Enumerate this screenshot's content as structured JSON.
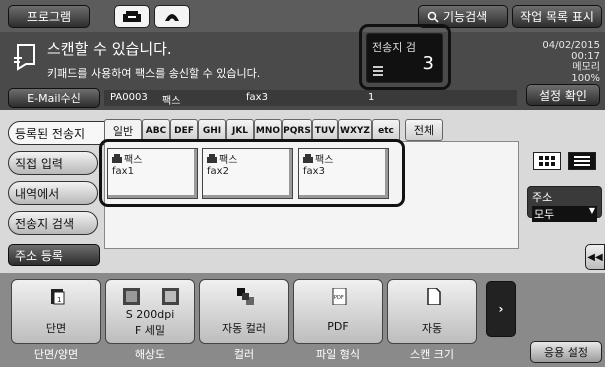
{
  "topbar": {
    "program_label": "프로그램",
    "function_search_label": "기능검색",
    "job_list_label": "작업 목록 표시"
  },
  "message": {
    "line1": "스캔할 수 있습니다.",
    "line2": "키패드를 사용하여 팩스를 송신할 수 있습니다.",
    "date": "04/02/2015",
    "time": "00:17",
    "memory_label": "메모리",
    "memory_value": "100%"
  },
  "destination_count": {
    "label": "전송지 검",
    "value": "3"
  },
  "email_receive_label": "E-Mail수신",
  "settings_confirm_label": "설정 확인",
  "dest_row": {
    "id": "PA0003",
    "type": "팩스",
    "name": "fax3",
    "count": "1"
  },
  "index_tabs": [
    "일반",
    "ABC",
    "DEF",
    "GHI",
    "JKL",
    "MNO",
    "PQRS",
    "TUV",
    "WXYZ",
    "etc"
  ],
  "all_tab_label": "전체",
  "destinations": [
    {
      "type": "팩스",
      "name": "fax1"
    },
    {
      "type": "팩스",
      "name": "fax2"
    },
    {
      "type": "팩스",
      "name": "fax3"
    }
  ],
  "left_menu": {
    "registered": "등록된 전송지",
    "direct": "직접 입력",
    "history": "내역에서",
    "search": "전송지 검색",
    "register": "주소 등록"
  },
  "address": {
    "label": "주소",
    "selected": "모두"
  },
  "function_buttons": [
    {
      "value": "단면",
      "sub": "",
      "label": "단면/양면",
      "icon": "simplex-icon"
    },
    {
      "value": "S 200dpi",
      "sub": "F 세밀",
      "label": "해상도",
      "icon": "resolution-icon"
    },
    {
      "value": "자동 컬러",
      "sub": "",
      "label": "컬러",
      "icon": "color-icon"
    },
    {
      "value": "PDF",
      "sub": "",
      "label": "파일 형식",
      "icon": "pdf-file-icon"
    },
    {
      "value": "자동",
      "sub": "",
      "label": "스캔 크기",
      "icon": "page-size-icon"
    }
  ],
  "application_settings_label": "응용 설정",
  "colors": {
    "accent_dark": "#111111",
    "panel": "#4a4a4a",
    "button_light": "#f0f0f0"
  }
}
